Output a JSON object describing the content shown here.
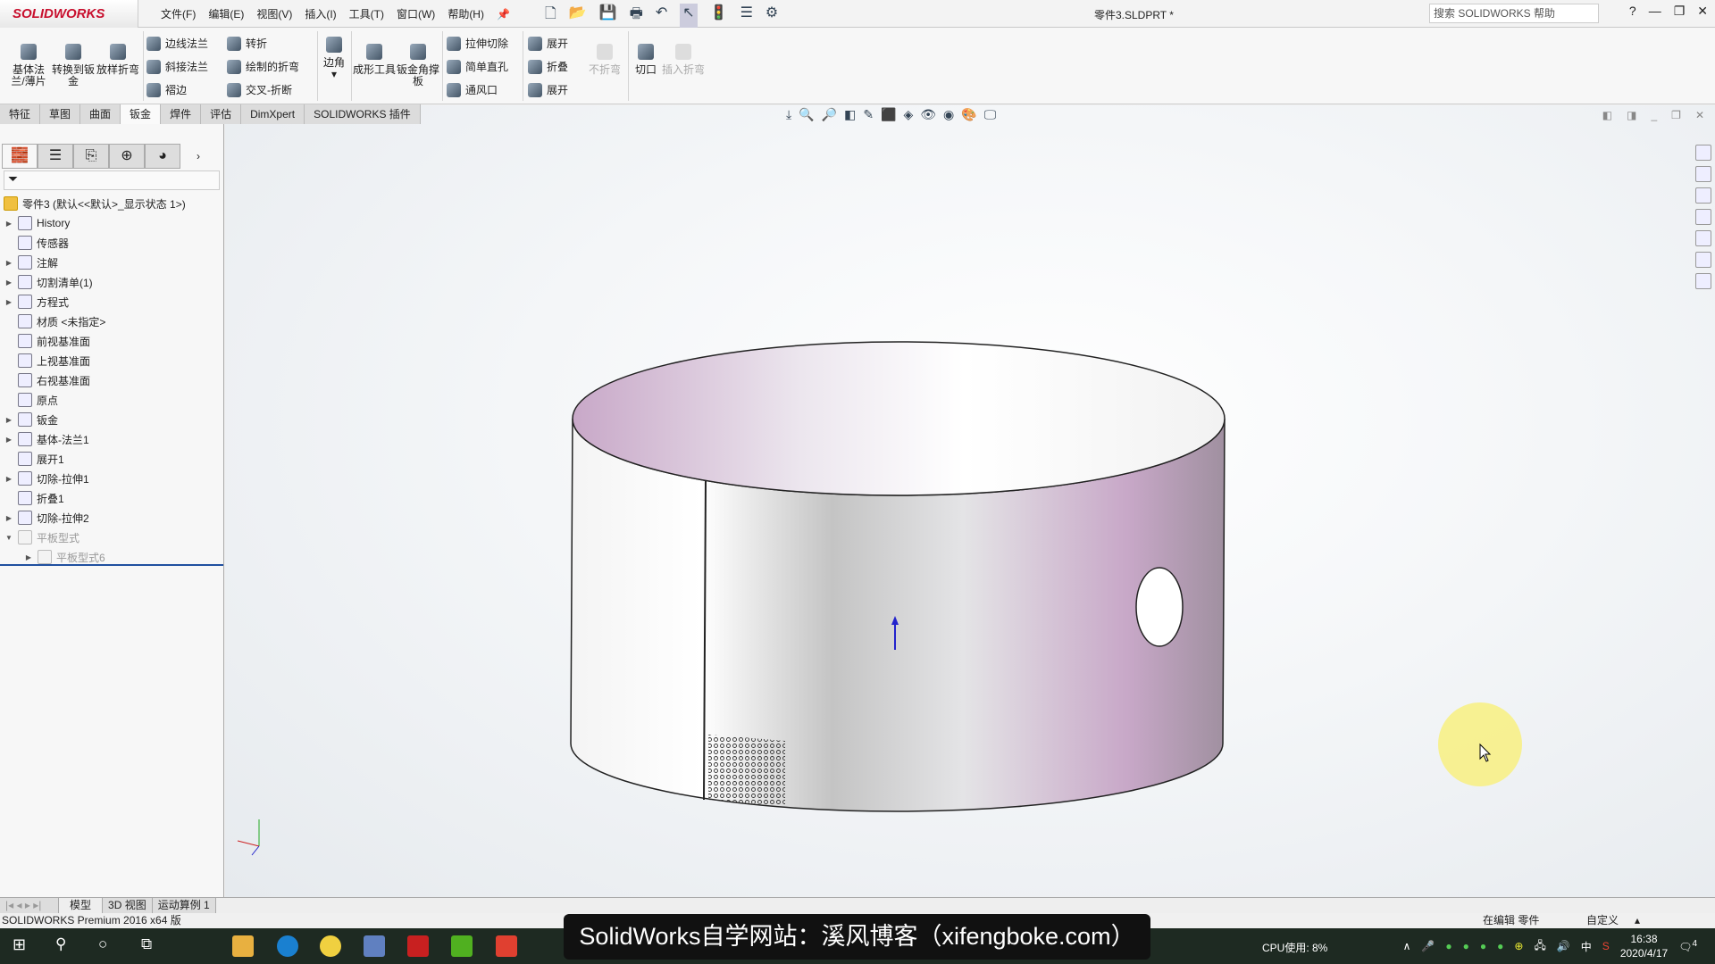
{
  "app": {
    "logo": "SOLIDWORKS",
    "document_title": "零件3.SLDPRT *",
    "help_search_placeholder": "搜索 SOLIDWORKS 帮助"
  },
  "menu": [
    "文件(F)",
    "编辑(E)",
    "视图(V)",
    "插入(I)",
    "工具(T)",
    "窗口(W)",
    "帮助(H)"
  ],
  "ribbon": {
    "big": [
      "基体法兰/薄片",
      "转换到钣金",
      "放样折弯"
    ],
    "col1": [
      "边线法兰",
      "斜接法兰",
      "褶边"
    ],
    "col2": [
      "转折",
      "绘制的折弯",
      "交叉-折断"
    ],
    "corner": "边角",
    "forming": "成形工具",
    "gusset": "钣金角撑板",
    "col3": [
      "拉伸切除",
      "简单直孔",
      "通风口"
    ],
    "col4": [
      "展开",
      "折叠",
      "展开"
    ],
    "unfold_disabled": "不折弯",
    "rip": "切口",
    "insert_bends": "插入折弯"
  },
  "command_tabs": [
    "特征",
    "草图",
    "曲面",
    "钣金",
    "焊件",
    "评估",
    "DimXpert",
    "SOLIDWORKS 插件"
  ],
  "active_tab": "钣金",
  "tree": {
    "root": "零件3 (默认<<默认>_显示状态 1>)",
    "items": [
      {
        "label": "History",
        "expand": true
      },
      {
        "label": "传感器",
        "expand": false
      },
      {
        "label": "注解",
        "expand": true
      },
      {
        "label": "切割清单(1)",
        "expand": true
      },
      {
        "label": "方程式",
        "expand": true
      },
      {
        "label": "材质 <未指定>",
        "expand": false
      },
      {
        "label": "前视基准面",
        "expand": false
      },
      {
        "label": "上视基准面",
        "expand": false
      },
      {
        "label": "右视基准面",
        "expand": false
      },
      {
        "label": "原点",
        "expand": false
      },
      {
        "label": "钣金",
        "expand": true
      },
      {
        "label": "基体-法兰1",
        "expand": true
      },
      {
        "label": "展开1",
        "expand": false
      },
      {
        "label": "切除-拉伸1",
        "expand": true
      },
      {
        "label": "折叠1",
        "expand": false
      },
      {
        "label": "切除-拉伸2",
        "expand": true
      },
      {
        "label": "平板型式",
        "expand": true,
        "suppressed": true
      },
      {
        "label": "平板型式6",
        "expand": true,
        "suppressed": true
      }
    ]
  },
  "bottom_tabs": [
    "模型",
    "3D 视图",
    "运动算例 1"
  ],
  "status": {
    "left": "SOLIDWORKS Premium 2016 x64 版",
    "mode": "在编辑 零件",
    "units": "自定义"
  },
  "subtitle": "SolidWorks自学网站：溪风博客（xifengboke.com）",
  "taskbar": {
    "cpu": "CPU使用: 8%",
    "ime": "中",
    "time": "16:38",
    "date": "2020/4/17",
    "notifications": "4"
  },
  "colors": {
    "brand": "#c8102e",
    "part_purple": "#c8a8c8",
    "selection": "#2050a0"
  }
}
